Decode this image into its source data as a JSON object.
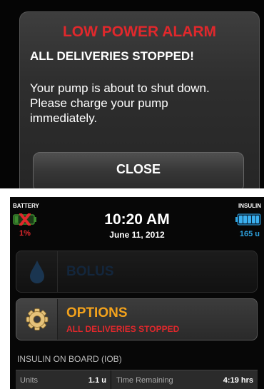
{
  "alarm": {
    "title": "LOW POWER ALARM",
    "subtitle": "ALL DELIVERIES STOPPED!",
    "message": "Your pump is about to shut down.\nPlease charge your pump\nimmediately.",
    "close_label": "CLOSE"
  },
  "status_bar": {
    "battery_label": "BATTERY",
    "battery_percent": "1%",
    "battery_icon": "battery-empty-x-icon",
    "insulin_label": "INSULIN",
    "insulin_units": "165 u",
    "insulin_icon": "insulin-cartridge-icon",
    "time": "10:20 AM",
    "date": "June 11, 2012"
  },
  "menu": {
    "bolus_label": "BOLUS",
    "bolus_icon": "drop-icon",
    "options_label": "OPTIONS",
    "options_status": "ALL DELIVERIES STOPPED",
    "options_icon": "gear-icon"
  },
  "iob": {
    "header": "INSULIN ON BOARD (IOB)",
    "units_label": "Units",
    "units_value": "1.1 u",
    "time_label": "Time Remaining",
    "time_value": "4:19 hrs"
  },
  "colors": {
    "alarm_red": "#e0282c",
    "options_orange": "#f3a21c",
    "insulin_blue": "#2fa3e0",
    "battery_green": "#3c8c2e"
  }
}
